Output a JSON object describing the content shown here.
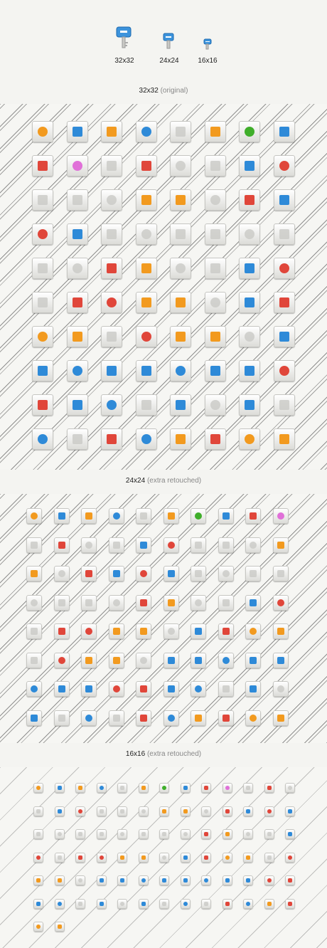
{
  "header": {
    "sizes": [
      {
        "label": "32x32",
        "icon": "key-icon"
      },
      {
        "label": "24x24",
        "icon": "key-icon"
      },
      {
        "label": "16x16",
        "icon": "key-icon"
      }
    ]
  },
  "sections": [
    {
      "title": "32x32",
      "note": "(original)"
    },
    {
      "title": "24x24",
      "note": "(extra retouched)"
    },
    {
      "title": "16x16",
      "note": "(extra retouched)"
    }
  ],
  "colors": {
    "orange": "#f29a1f",
    "red": "#e0463a",
    "blue": "#2e8ad8",
    "green": "#3fae2a",
    "pink": "#e070d8",
    "gray": "#c9c9c5"
  },
  "icons": [
    {
      "name": "home-icon",
      "color": "orange"
    },
    {
      "name": "magnifier-icon",
      "color": "blue"
    },
    {
      "name": "rss-icon",
      "color": "orange"
    },
    {
      "name": "sign-icon",
      "color": "blue"
    },
    {
      "name": "flag-gray-icon",
      "color": "gray"
    },
    {
      "name": "flag-orange-icon",
      "color": "orange"
    },
    {
      "name": "flag-green-icon",
      "color": "green"
    },
    {
      "name": "flag-blue-icon",
      "color": "blue"
    },
    {
      "name": "flag-red-icon",
      "color": "red"
    },
    {
      "name": "flag-pink-icon",
      "color": "pink"
    },
    {
      "name": "floppy-icon",
      "color": "gray"
    },
    {
      "name": "floppy-red-icon",
      "color": "red"
    },
    {
      "name": "folder-icon",
      "color": "gray"
    },
    {
      "name": "server-icon",
      "color": "gray"
    },
    {
      "name": "clock-icon",
      "color": "blue"
    },
    {
      "name": "bug-icon",
      "color": "red"
    },
    {
      "name": "user-icon",
      "color": "gray"
    },
    {
      "name": "users-icon",
      "color": "gray"
    },
    {
      "name": "user-silhouette-icon",
      "color": "gray"
    },
    {
      "name": "pencil-icon",
      "color": "orange"
    },
    {
      "name": "bulb-on-icon",
      "color": "orange"
    },
    {
      "name": "bulb-off-icon",
      "color": "gray"
    },
    {
      "name": "lock-icon",
      "color": "red"
    },
    {
      "name": "unlock-icon",
      "color": "blue"
    },
    {
      "name": "shield-red-icon",
      "color": "red"
    },
    {
      "name": "shield-blue-icon",
      "color": "blue"
    },
    {
      "name": "arrow-right-icon",
      "color": "gray"
    },
    {
      "name": "arrow-down-icon",
      "color": "gray"
    },
    {
      "name": "arrow-left-icon",
      "color": "gray"
    },
    {
      "name": "arrow-up-icon",
      "color": "gray"
    },
    {
      "name": "plus-icon",
      "color": "gray"
    },
    {
      "name": "minus-icon",
      "color": "gray"
    },
    {
      "name": "cross-icon",
      "color": "gray"
    },
    {
      "name": "check-icon",
      "color": "gray"
    },
    {
      "name": "stop-icon",
      "color": "red"
    },
    {
      "name": "warning-icon",
      "color": "orange"
    },
    {
      "name": "refresh-icon",
      "color": "gray"
    },
    {
      "name": "cart-remove-icon",
      "color": "gray"
    },
    {
      "name": "cart-add-icon",
      "color": "blue"
    },
    {
      "name": "magic-wand-icon",
      "color": "red"
    },
    {
      "name": "mail-icon",
      "color": "gray"
    },
    {
      "name": "mail-red-icon",
      "color": "red"
    },
    {
      "name": "heart-icon",
      "color": "red"
    },
    {
      "name": "star-icon",
      "color": "orange"
    },
    {
      "name": "star-half-icon",
      "color": "orange"
    },
    {
      "name": "star-empty-icon",
      "color": "gray"
    },
    {
      "name": "thumbs-up-icon",
      "color": "blue"
    },
    {
      "name": "thumbs-down-icon",
      "color": "red"
    },
    {
      "name": "wrench-icon",
      "color": "orange"
    },
    {
      "name": "gear-icon",
      "color": "orange"
    },
    {
      "name": "trash-icon",
      "color": "gray"
    },
    {
      "name": "trash-red-icon",
      "color": "red"
    },
    {
      "name": "badge-icon",
      "color": "orange"
    },
    {
      "name": "tag-icon",
      "color": "orange"
    },
    {
      "name": "speech-bubble-icon",
      "color": "gray"
    },
    {
      "name": "calendar-icon",
      "color": "blue"
    },
    {
      "name": "cd-icon",
      "color": "blue"
    },
    {
      "name": "mobile-icon",
      "color": "blue"
    },
    {
      "name": "tablet-icon",
      "color": "blue"
    },
    {
      "name": "monitor-icon",
      "color": "blue"
    },
    {
      "name": "network-icon",
      "color": "blue"
    },
    {
      "name": "computer-icon",
      "color": "blue"
    },
    {
      "name": "calculator-icon",
      "color": "blue"
    },
    {
      "name": "printer-icon",
      "color": "red"
    },
    {
      "name": "bomb-icon",
      "color": "red"
    },
    {
      "name": "document-icon",
      "color": "blue"
    },
    {
      "name": "documents-icon",
      "color": "blue"
    },
    {
      "name": "clipboard-icon",
      "color": "gray"
    },
    {
      "name": "briefcase-icon",
      "color": "blue"
    },
    {
      "name": "scissors-icon",
      "color": "gray"
    },
    {
      "name": "credit-card-icon",
      "color": "blue"
    },
    {
      "name": "card-icon",
      "color": "gray"
    },
    {
      "name": "broom-icon",
      "color": "blue"
    },
    {
      "name": "target-icon",
      "color": "gray"
    },
    {
      "name": "target-remove-icon",
      "color": "red"
    },
    {
      "name": "help-icon",
      "color": "blue"
    },
    {
      "name": "info-icon",
      "color": "orange"
    },
    {
      "name": "lifebuoy-icon",
      "color": "red"
    },
    {
      "name": "pie-chart-icon",
      "color": "orange"
    },
    {
      "name": "bar-chart-icon",
      "color": "orange"
    }
  ]
}
